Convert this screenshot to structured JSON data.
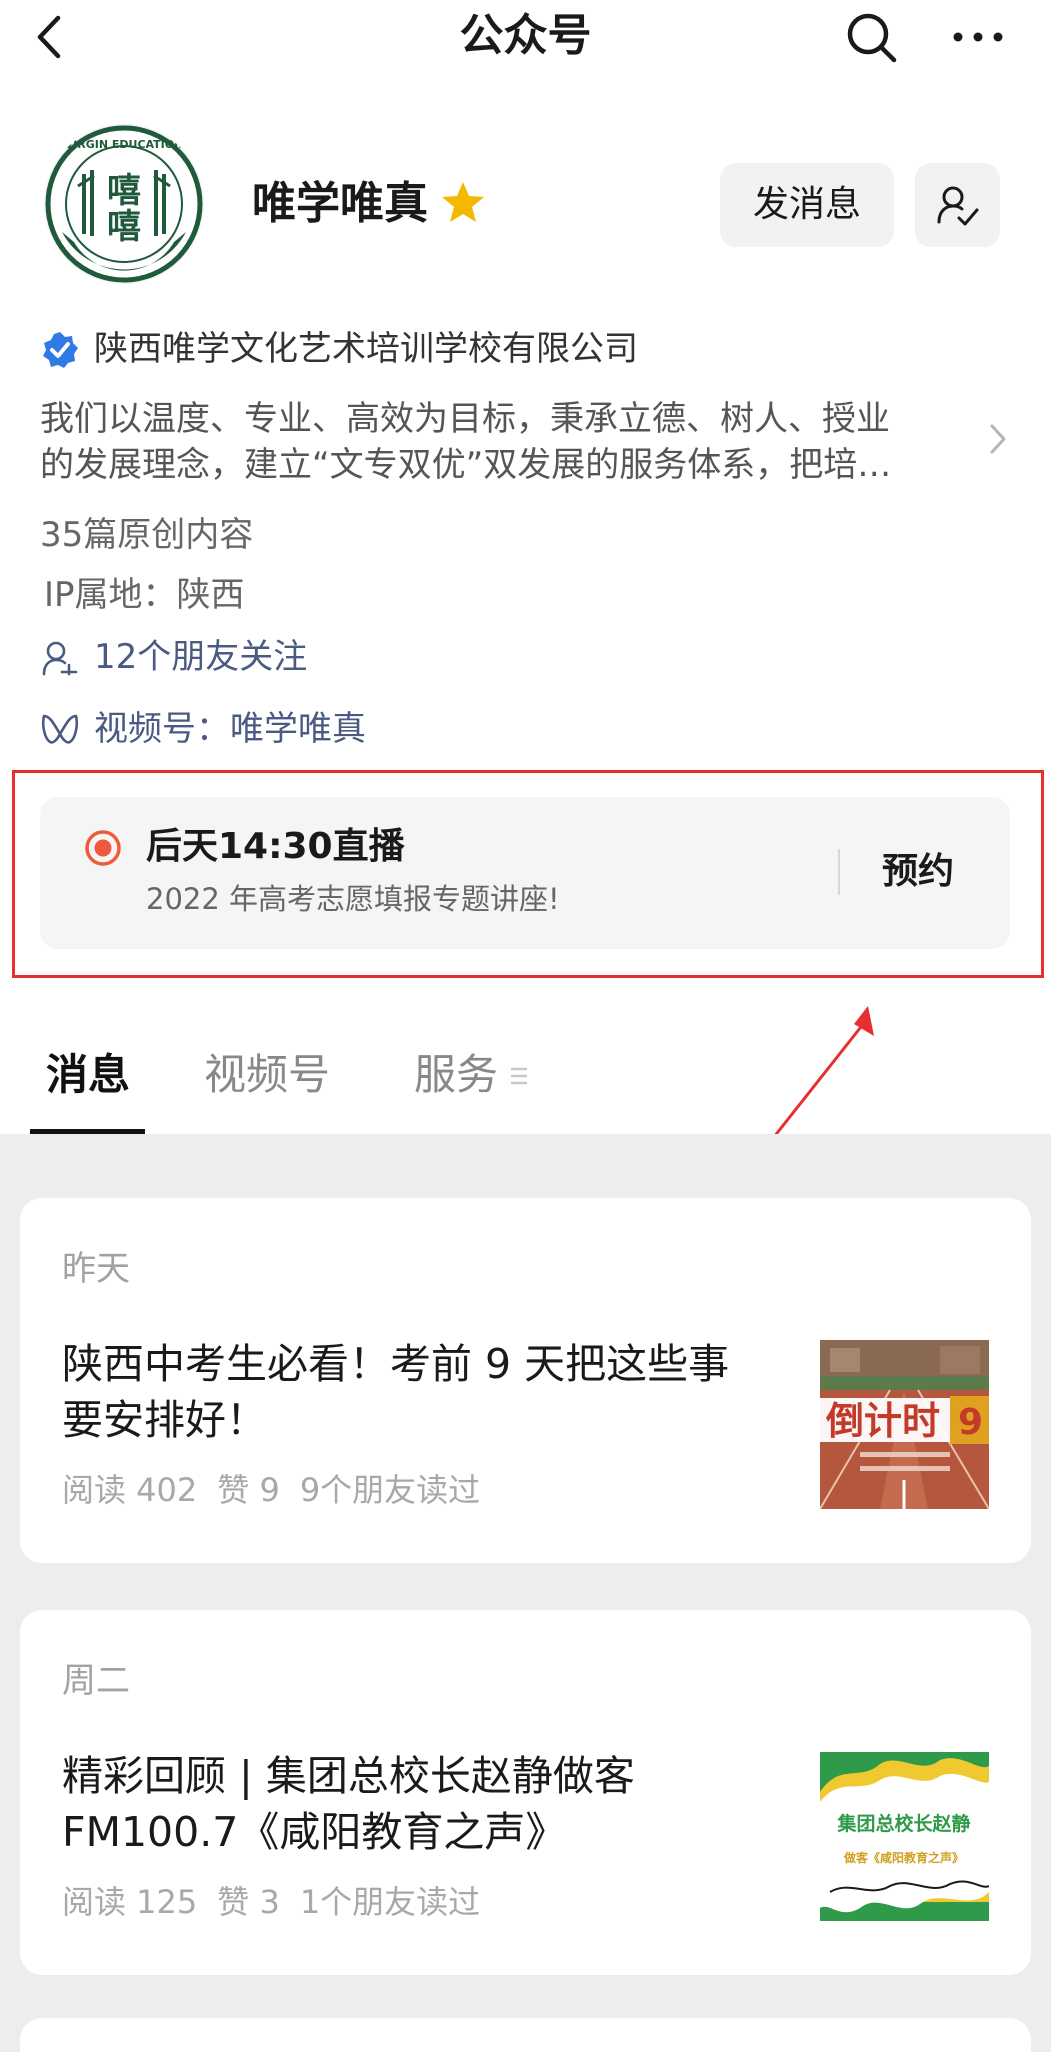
{
  "nav": {
    "title": "公众号"
  },
  "account": {
    "name": "唯学唯真",
    "send_message_label": "发消息",
    "verified_company": "陕西唯学文化艺术培训学校有限公司",
    "description_lines": [
      "我们以温度、专业、高效为目标，秉承立德、树人、授业",
      "的发展理念，建立“文专双优”双发展的服务体系，把培…"
    ],
    "original_count": "35篇原创内容",
    "ip_location": "IP属地：陕西",
    "friends_following": "12个朋友关注",
    "channel_label": "视频号：",
    "channel_name": "唯学唯真",
    "avatar_texts": {
      "ring": "VIRGIN EDUCATION",
      "center_top": "嘻",
      "center_bottom": "嘻"
    }
  },
  "live": {
    "title": "后天14:30直播",
    "subtitle": "2022 年高考志愿填报专题讲座!",
    "reserve_label": "预约"
  },
  "tabs": [
    {
      "label": "消息",
      "active": true
    },
    {
      "label": "视频号",
      "active": false
    },
    {
      "label": "服务",
      "active": false
    }
  ],
  "articles": [
    {
      "day": "昨天",
      "title_lines": [
        "陕西中考生必看！考前 9 天把这些事",
        "要安排好！"
      ],
      "reads": "阅读 402",
      "likes": "赞 9",
      "friends_read": "9个朋友读过",
      "thumb_text": "倒计时",
      "thumb_number": "9"
    },
    {
      "day": "周二",
      "title_lines": [
        "精彩回顾 | 集团总校长赵静做客",
        "FM100.7《咸阳教育之声》"
      ],
      "reads": "阅读 125",
      "likes": "赞 3",
      "friends_read": "1个朋友读过",
      "thumb_text": "集团总校长赵静",
      "thumb_sub": "做客《咸阳教育之声》"
    }
  ],
  "colors": {
    "highlight": "#e5302f",
    "link": "#4a5a82",
    "verify": "#2f7ae5",
    "star": "#f5b800",
    "live_dot": "#f05a3c",
    "feed_bg": "#ededed"
  }
}
